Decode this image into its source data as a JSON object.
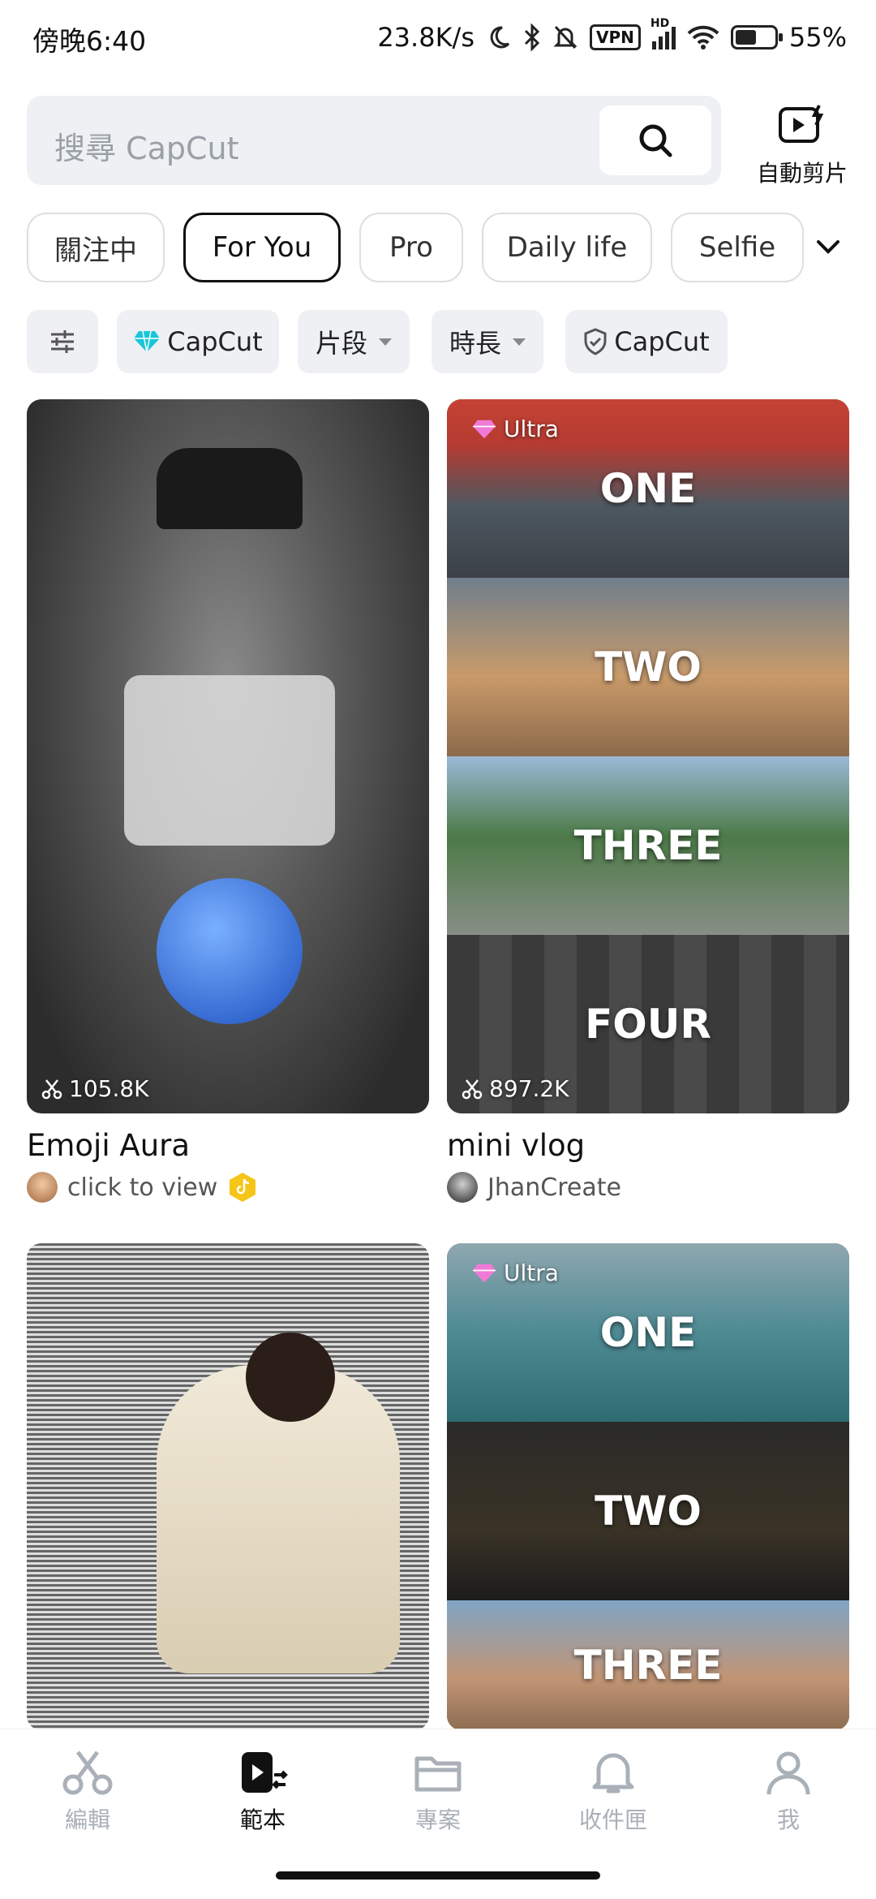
{
  "status_bar": {
    "time": "傍晚6:40",
    "speed": "23.8K/s",
    "vpn": "VPN",
    "network": "HD",
    "battery": "55%",
    "battery_level": 0.55
  },
  "search": {
    "placeholder": "搜尋 CapCut"
  },
  "auto_cut": {
    "label": "自動剪片"
  },
  "tabs": [
    {
      "label": "關注中",
      "active": false
    },
    {
      "label": "For You",
      "active": true
    },
    {
      "label": "Pro",
      "active": false
    },
    {
      "label": "Daily life",
      "active": false
    },
    {
      "label": "Selfie",
      "active": false
    }
  ],
  "filters": {
    "capcut_pro": "CapCut",
    "segments": "片段",
    "duration": "時長",
    "capcut_verified": "CapCut"
  },
  "cards": [
    {
      "title": "Emoji Aura",
      "author": "click to view",
      "uses": "105.8K",
      "ultra": false
    },
    {
      "title": "mini vlog",
      "author": "JhanCreate",
      "uses": "897.2K",
      "ultra": true,
      "badge": "Ultra",
      "segments": [
        "ONE",
        "TWO",
        "THREE",
        "FOUR"
      ]
    },
    {
      "title": "",
      "author": "",
      "uses": "",
      "ultra": false
    },
    {
      "ultra": true,
      "badge": "Ultra",
      "segments": [
        "ONE",
        "TWO",
        "THREE"
      ]
    }
  ],
  "nav": [
    {
      "label": "編輯",
      "icon": "scissors-icon",
      "active": false
    },
    {
      "label": "範本",
      "icon": "template-icon",
      "active": true
    },
    {
      "label": "專案",
      "icon": "folder-icon",
      "active": false
    },
    {
      "label": "收件匣",
      "icon": "bell-icon",
      "active": false
    },
    {
      "label": "我",
      "icon": "person-icon",
      "active": false
    }
  ],
  "colors": {
    "accent_cyan": "#19c6d8",
    "verified_gold": "#f5c518",
    "inactive_gray": "#aab0b8"
  }
}
